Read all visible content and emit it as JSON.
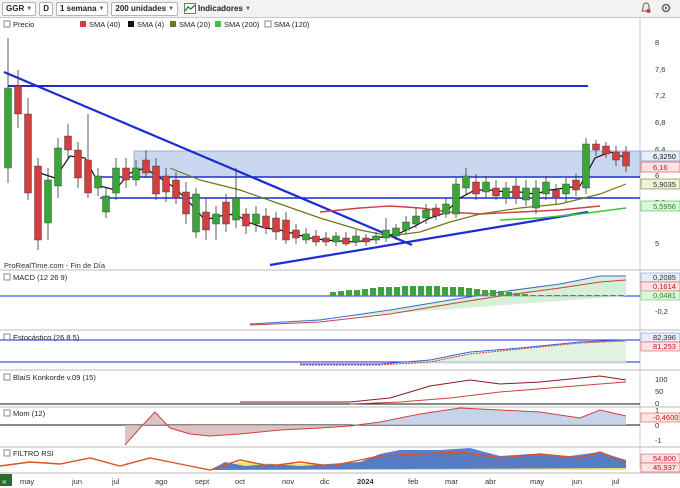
{
  "toolbar": {
    "symbol": "GGR",
    "d_label": "D",
    "period": "1 semana",
    "units": "200 unidades",
    "indicators_label": "Indicadores"
  },
  "legend": {
    "price": "Precio",
    "sma40": "SMA (40)",
    "sma4": "SMA (4)",
    "sma20": "SMA (20)",
    "sma200": "SMA (200)",
    "sma120": "SMA (120)"
  },
  "watermark": "ProRealTime.com - Fin de Día",
  "price_axis": [
    "8",
    "7,6",
    "7,2",
    "6,8",
    "6,4",
    "6",
    "5,6",
    "5"
  ],
  "price_tags": {
    "t1": "6,3250",
    "t2": "6,16",
    "t3": "5,9035",
    "t4": "5,5956"
  },
  "macd": {
    "label": "MACD (12 26 9)",
    "tag1": "0,2085",
    "tag2": "0,1614",
    "tag3": "0,0481",
    "axis_lower": "-0,2"
  },
  "stoch": {
    "label": "Estocástico (26 8 5)",
    "tag1": "82,396",
    "tag2": "81,253"
  },
  "blais": {
    "label": "BlaiS Konkorde v.09 (15)",
    "axis": [
      "100",
      "50",
      "0"
    ]
  },
  "mom": {
    "label": "Mom (12)",
    "tag1": "-0,4600",
    "axis": [
      "1",
      "0",
      "-1"
    ]
  },
  "rsi": {
    "label": "FILTRO RSI",
    "tag1": "45,937",
    "tag2": "54,800"
  },
  "time_axis": [
    "may",
    "jun",
    "jul",
    "ago",
    "sept",
    "oct",
    "nov",
    "dic",
    "2024",
    "feb",
    "mar",
    "abr",
    "may",
    "jun",
    "jul"
  ],
  "colors": {
    "up": "#3aa63a",
    "down": "#d04040",
    "trend": "#1a2bd8",
    "zone": "#c9d8f0"
  }
}
